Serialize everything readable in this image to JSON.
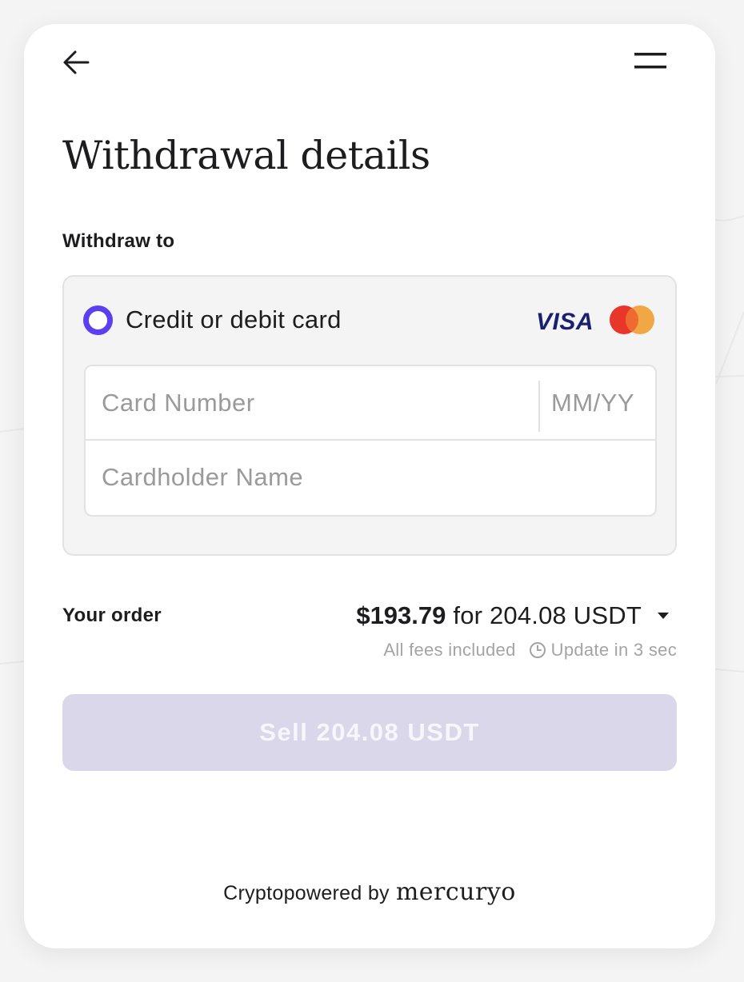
{
  "header": {
    "back_icon": "arrow-left-icon",
    "menu_icon": "hamburger-menu-icon",
    "title": "Withdrawal details"
  },
  "withdraw": {
    "section_label": "Withdraw to",
    "method_label": "Credit or debit card",
    "visa_text": "VISA",
    "radio_color": "#5b3ff0",
    "fields": {
      "card_number_placeholder": "Card Number",
      "expiry_placeholder": "MM/YY",
      "cardholder_placeholder": "Cardholder Name"
    }
  },
  "order": {
    "label": "Your order",
    "price": "$193.79",
    "for_text": "for 204.08 USDT",
    "fees_note": "All fees included",
    "update_note": "Update in 3 sec",
    "caret_icon": "caret-down-icon",
    "clock_icon": "clock-icon"
  },
  "sell_button": {
    "label": "Sell 204.08 USDT",
    "background": "#dad7ea"
  },
  "footer": {
    "text": "Cryptopowered by",
    "brand": "mercuryo"
  }
}
